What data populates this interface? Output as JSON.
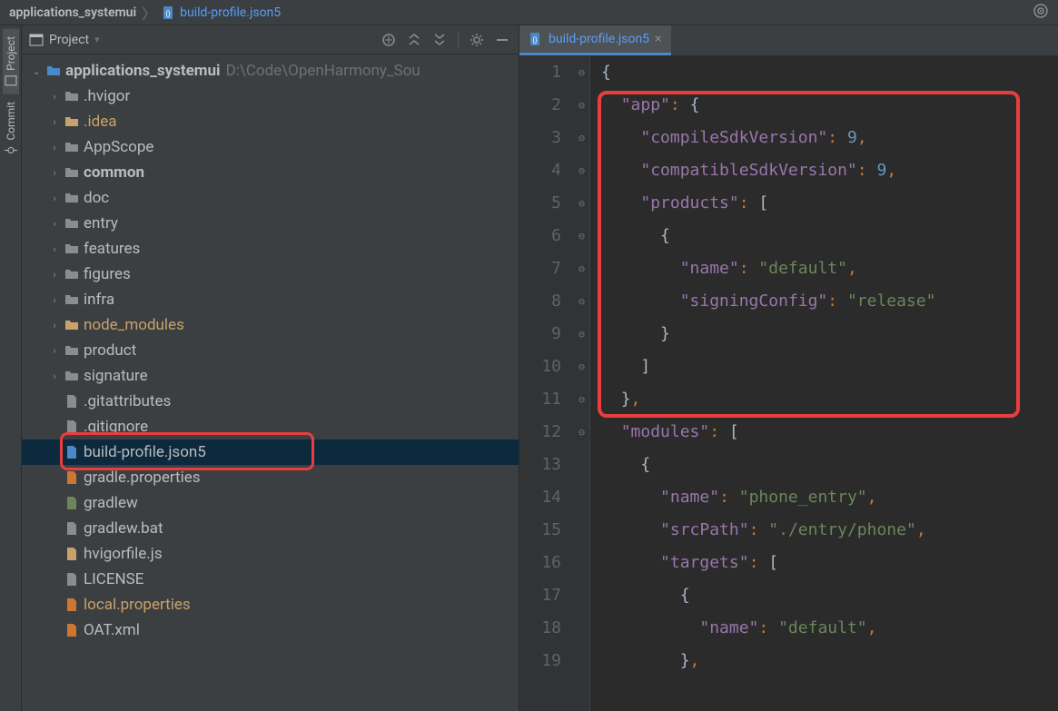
{
  "breadcrumb": {
    "root": "applications_systemui",
    "file": "build-profile.json5"
  },
  "gear_icon": "⚙",
  "left_rail": {
    "tabs": [
      {
        "label": "Project",
        "active": true
      },
      {
        "label": "Commit",
        "active": false
      }
    ]
  },
  "project_panel": {
    "title": "Project",
    "view_dropdown": "▾",
    "header_icons": {
      "target": "⊕",
      "collapse": "⇱",
      "expand": "⇲",
      "settings": "⚙",
      "hide": "—"
    },
    "root": {
      "name": "applications_systemui",
      "path": "D:\\Code\\OpenHarmony_Sou"
    },
    "children": [
      {
        "name": ".hvigor",
        "type": "folder",
        "expandable": true,
        "style": "normal"
      },
      {
        "name": ".idea",
        "type": "folder",
        "expandable": true,
        "style": "yellow"
      },
      {
        "name": "AppScope",
        "type": "folder",
        "expandable": true,
        "style": "normal"
      },
      {
        "name": "common",
        "type": "folder",
        "expandable": true,
        "style": "bold"
      },
      {
        "name": "doc",
        "type": "folder",
        "expandable": true,
        "style": "normal"
      },
      {
        "name": "entry",
        "type": "folder",
        "expandable": true,
        "style": "normal"
      },
      {
        "name": "features",
        "type": "folder",
        "expandable": true,
        "style": "normal"
      },
      {
        "name": "figures",
        "type": "folder",
        "expandable": true,
        "style": "normal"
      },
      {
        "name": "infra",
        "type": "folder",
        "expandable": true,
        "style": "normal"
      },
      {
        "name": "node_modules",
        "type": "folder",
        "expandable": true,
        "style": "yellow"
      },
      {
        "name": "product",
        "type": "folder",
        "expandable": true,
        "style": "normal"
      },
      {
        "name": "signature",
        "type": "folder",
        "expandable": true,
        "style": "normal"
      },
      {
        "name": ".gitattributes",
        "type": "file",
        "icon": "text"
      },
      {
        "name": ".gitignore",
        "type": "file",
        "icon": "text"
      },
      {
        "name": "build-profile.json5",
        "type": "file",
        "icon": "json",
        "selected": true,
        "highlighted": true
      },
      {
        "name": "gradle.properties",
        "type": "file",
        "icon": "props"
      },
      {
        "name": "gradlew",
        "type": "file",
        "icon": "exec"
      },
      {
        "name": "gradlew.bat",
        "type": "file",
        "icon": "text"
      },
      {
        "name": "hvigorfile.js",
        "type": "file",
        "icon": "js"
      },
      {
        "name": "LICENSE",
        "type": "file",
        "icon": "text"
      },
      {
        "name": "local.properties",
        "type": "file",
        "icon": "props",
        "style": "yellow"
      },
      {
        "name": "OAT.xml",
        "type": "file",
        "icon": "xml"
      }
    ]
  },
  "editor": {
    "tab_label": "build-profile.json5",
    "lines": [
      {
        "n": 1,
        "indent": 0,
        "tokens": [
          [
            "brace",
            "{"
          ]
        ]
      },
      {
        "n": 2,
        "indent": 1,
        "tokens": [
          [
            "key",
            "\"app\""
          ],
          [
            "punc",
            ": "
          ],
          [
            "brace",
            "{"
          ]
        ]
      },
      {
        "n": 3,
        "indent": 2,
        "tokens": [
          [
            "key",
            "\"compileSdkVersion\""
          ],
          [
            "punc",
            ": "
          ],
          [
            "num",
            "9"
          ],
          [
            "punc",
            ","
          ]
        ]
      },
      {
        "n": 4,
        "indent": 2,
        "tokens": [
          [
            "key",
            "\"compatibleSdkVersion\""
          ],
          [
            "punc",
            ": "
          ],
          [
            "num",
            "9"
          ],
          [
            "punc",
            ","
          ]
        ]
      },
      {
        "n": 5,
        "indent": 2,
        "tokens": [
          [
            "key",
            "\"products\""
          ],
          [
            "punc",
            ": "
          ],
          [
            "brace",
            "["
          ]
        ]
      },
      {
        "n": 6,
        "indent": 3,
        "tokens": [
          [
            "brace",
            "{"
          ]
        ]
      },
      {
        "n": 7,
        "indent": 4,
        "tokens": [
          [
            "key",
            "\"name\""
          ],
          [
            "punc",
            ": "
          ],
          [
            "str",
            "\"default\""
          ],
          [
            "punc",
            ","
          ]
        ]
      },
      {
        "n": 8,
        "indent": 4,
        "tokens": [
          [
            "key",
            "\"signingConfig\""
          ],
          [
            "punc",
            ": "
          ],
          [
            "str",
            "\"release\""
          ]
        ]
      },
      {
        "n": 9,
        "indent": 3,
        "tokens": [
          [
            "brace",
            "}"
          ]
        ]
      },
      {
        "n": 10,
        "indent": 2,
        "tokens": [
          [
            "brace",
            "]"
          ]
        ]
      },
      {
        "n": 11,
        "indent": 1,
        "tokens": [
          [
            "brace",
            "}"
          ],
          [
            "punc",
            ","
          ]
        ]
      },
      {
        "n": 12,
        "indent": 1,
        "tokens": [
          [
            "key",
            "\"modules\""
          ],
          [
            "punc",
            ": "
          ],
          [
            "brace",
            "["
          ]
        ]
      },
      {
        "n": 13,
        "indent": 2,
        "tokens": [
          [
            "brace",
            "{"
          ]
        ]
      },
      {
        "n": 14,
        "indent": 3,
        "tokens": [
          [
            "key",
            "\"name\""
          ],
          [
            "punc",
            ": "
          ],
          [
            "str",
            "\"phone_entry\""
          ],
          [
            "punc",
            ","
          ]
        ]
      },
      {
        "n": 15,
        "indent": 3,
        "tokens": [
          [
            "key",
            "\"srcPath\""
          ],
          [
            "punc",
            ": "
          ],
          [
            "str",
            "\"./entry/phone\""
          ],
          [
            "punc",
            ","
          ]
        ]
      },
      {
        "n": 16,
        "indent": 3,
        "tokens": [
          [
            "key",
            "\"targets\""
          ],
          [
            "punc",
            ": "
          ],
          [
            "brace",
            "["
          ]
        ]
      },
      {
        "n": 17,
        "indent": 4,
        "tokens": [
          [
            "brace",
            "{"
          ]
        ]
      },
      {
        "n": 18,
        "indent": 5,
        "tokens": [
          [
            "key",
            "\"name\""
          ],
          [
            "punc",
            ": "
          ],
          [
            "str",
            "\"default\""
          ],
          [
            "punc",
            ","
          ]
        ]
      },
      {
        "n": 19,
        "indent": 4,
        "tokens": [
          [
            "brace",
            "}"
          ],
          [
            "punc",
            ","
          ]
        ]
      }
    ],
    "fold_marks": {
      "1": "⊖",
      "2": "⊖",
      "5": "⊖",
      "6": "⊖",
      "9": "⊖",
      "10": "⊖",
      "11": "⊖",
      "12": "⊖",
      "13": "⊖",
      "16": "⊖",
      "17": "⊖",
      "19": "⊖"
    },
    "highlight_box": {
      "top_line": 2,
      "bottom_line": 11
    }
  }
}
